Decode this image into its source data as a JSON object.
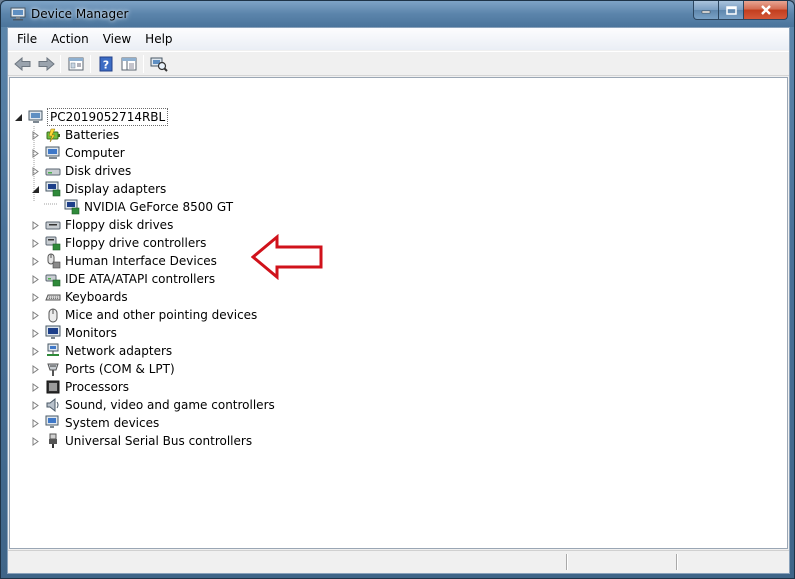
{
  "window": {
    "title": "Device Manager"
  },
  "menu": [
    {
      "label": "File"
    },
    {
      "label": "Action"
    },
    {
      "label": "View"
    },
    {
      "label": "Help"
    }
  ],
  "toolbar": {
    "buttons": [
      "back-icon",
      "forward-icon",
      "properties-icon",
      "help-icon",
      "console-tree-icon",
      "scan-hardware-icon"
    ]
  },
  "tree": {
    "root": {
      "label": "PC2019052714RBL",
      "expanded": true
    },
    "categories": [
      {
        "label": "Batteries",
        "icon": "battery-icon",
        "expanded": false
      },
      {
        "label": "Computer",
        "icon": "computer-icon",
        "expanded": false
      },
      {
        "label": "Disk drives",
        "icon": "disk-drive-icon",
        "expanded": false
      },
      {
        "label": "Display adapters",
        "icon": "display-adapter-icon",
        "expanded": true,
        "children": [
          {
            "label": "NVIDIA GeForce 8500 GT",
            "icon": "display-adapter-icon"
          }
        ]
      },
      {
        "label": "Floppy disk drives",
        "icon": "floppy-icon",
        "expanded": false
      },
      {
        "label": "Floppy drive controllers",
        "icon": "floppy-controller-icon",
        "expanded": false
      },
      {
        "label": "Human Interface Devices",
        "icon": "hid-icon",
        "expanded": false
      },
      {
        "label": "IDE ATA/ATAPI controllers",
        "icon": "ide-controller-icon",
        "expanded": false
      },
      {
        "label": "Keyboards",
        "icon": "keyboard-icon",
        "expanded": false
      },
      {
        "label": "Mice and other pointing devices",
        "icon": "mouse-icon",
        "expanded": false
      },
      {
        "label": "Monitors",
        "icon": "monitor-icon",
        "expanded": false
      },
      {
        "label": "Network adapters",
        "icon": "network-adapter-icon",
        "expanded": false
      },
      {
        "label": "Ports (COM & LPT)",
        "icon": "port-icon",
        "expanded": false
      },
      {
        "label": "Processors",
        "icon": "processor-icon",
        "expanded": false
      },
      {
        "label": "Sound, video and game controllers",
        "icon": "sound-icon",
        "expanded": false
      },
      {
        "label": "System devices",
        "icon": "system-devices-icon",
        "expanded": false
      },
      {
        "label": "Universal Serial Bus controllers",
        "icon": "usb-icon",
        "expanded": false
      }
    ]
  },
  "annotation": {
    "type": "arrow",
    "color": "#d0121b",
    "points_to": "NVIDIA GeForce 8500 GT"
  }
}
